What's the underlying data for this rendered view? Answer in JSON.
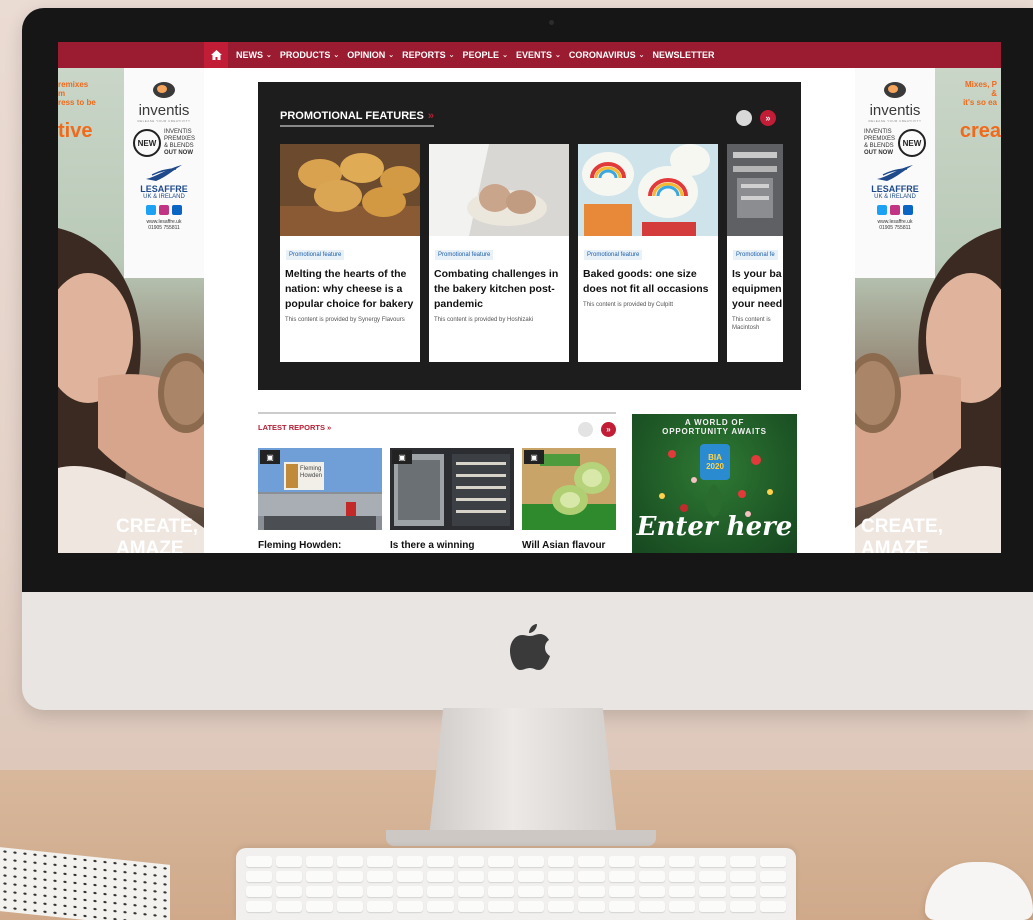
{
  "nav": {
    "items": [
      {
        "label": "NEWS",
        "dropdown": true
      },
      {
        "label": "PRODUCTS",
        "dropdown": true
      },
      {
        "label": "OPINION",
        "dropdown": true
      },
      {
        "label": "REPORTS",
        "dropdown": true
      },
      {
        "label": "PEOPLE",
        "dropdown": true
      },
      {
        "label": "EVENTS",
        "dropdown": true
      },
      {
        "label": "CORONAVIRUS",
        "dropdown": true
      },
      {
        "label": "NEWSLETTER",
        "dropdown": false
      }
    ],
    "chevron": "⌄",
    "home_icon": "home-icon"
  },
  "promo": {
    "title": "PROMOTIONAL FEATURES",
    "title_arrow": "»",
    "next_label": "»",
    "cards": [
      {
        "tag": "Promotional feature",
        "title": "Melting the hearts of the nation: why cheese is a popular choice for bakery",
        "provided": "This content is provided by Synergy Flavours"
      },
      {
        "tag": "Promotional feature",
        "title": "Combating challenges in the bakery kitchen post-pandemic",
        "provided": "This content is provided by Hoshizaki"
      },
      {
        "tag": "Promotional feature",
        "title": "Baked goods: one size does not fit all occasions",
        "provided": "This content is provided by Culpitt"
      },
      {
        "tag": "Promotional fe",
        "title": "Is your ba equipmen your need",
        "provided": "This content is Macintosh"
      }
    ]
  },
  "latest": {
    "title": "LATEST REPORTS »",
    "next_label": "»",
    "reports": [
      {
        "title": "Fleming Howden:",
        "image_text": "Fleming Howden",
        "icon": "camera-icon"
      },
      {
        "title": "Is there a winning",
        "icon": "camera-icon"
      },
      {
        "title": "Will Asian flavour",
        "icon": "camera-icon"
      }
    ]
  },
  "ads": {
    "left": {
      "orange_lines": [
        "remixes",
        "m",
        "ress to be"
      ],
      "big": "tive",
      "create_lines": [
        "CREATE,",
        "AMAZE"
      ]
    },
    "right": {
      "orange_lines": [
        "Mixes, P",
        "&",
        "it's so ea"
      ],
      "big": "crea",
      "create_lines": [
        "CREATE,",
        "AMAZE"
      ]
    },
    "brand": "inventis",
    "brand_tag": "RELEASE YOUR CREATIVITY",
    "new_badge": "NEW",
    "desc_lines": [
      "INVENTIS",
      "PREMIXES",
      "& BLENDS",
      "OUT NOW"
    ],
    "lesaffre": "LESAFFRE",
    "lesaffre_sub": "UK & IRELAND",
    "contact_lines": [
      "www.lesaffre.uk",
      "01905 755811"
    ]
  },
  "bia": {
    "head_lines": [
      "A WORLD OF",
      "OPPORTUNITY AWAITS"
    ],
    "badge_lines": [
      "BIA",
      "2020"
    ],
    "cta": "Enter here"
  },
  "colors": {
    "nav_bg": "#9b1b30",
    "accent": "#c21d36",
    "promo_bg": "#1d1d1d",
    "tag_text": "#1e5fa8",
    "orange": "#f06a1c",
    "lesaffre_blue": "#1e4a8c"
  }
}
